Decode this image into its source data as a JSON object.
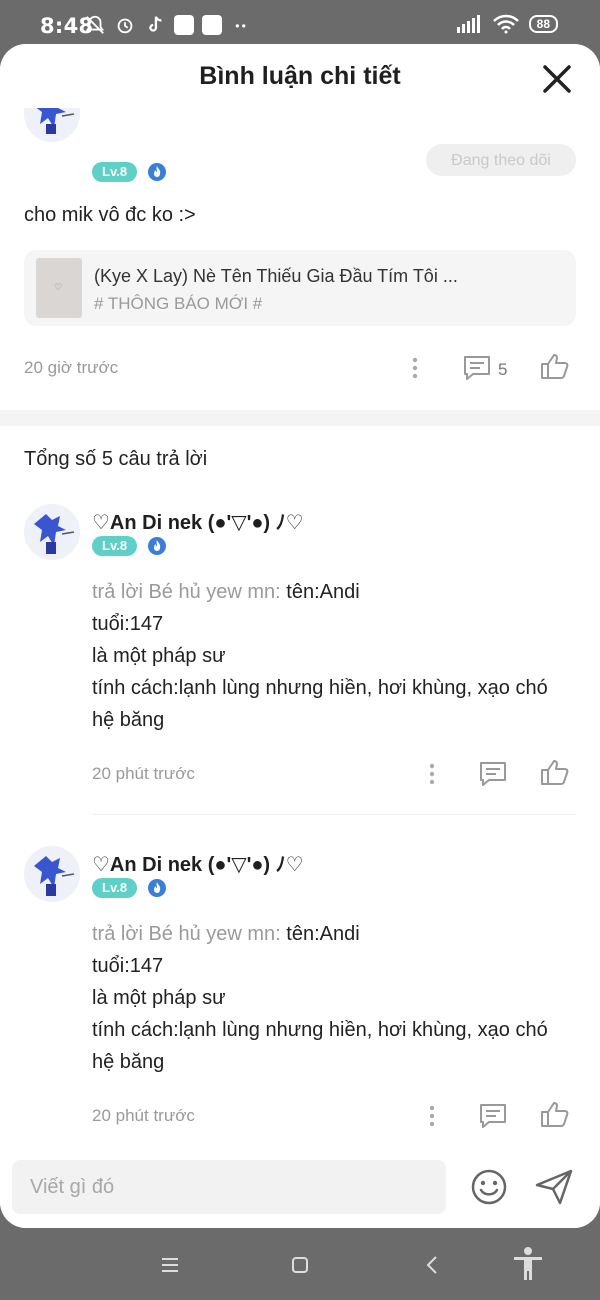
{
  "status_bar": {
    "time": "8:48",
    "battery": "88"
  },
  "header": {
    "title": "Bình luận chi tiết"
  },
  "top_comment": {
    "level": "Lv.8",
    "follow_label": "Đang theo dõi",
    "text": "cho mik vô đc ko :>",
    "story": {
      "thumb_glyph": "♡",
      "title": "(Kye X Lay) Nè Tên Thiếu Gia Đầu Tím Tôi ...",
      "tag": "# THÔNG BÁO MỚI #"
    },
    "time": "20 giờ trước",
    "reply_count": "5"
  },
  "total_replies": "Tổng số 5 câu trả lời",
  "replies": [
    {
      "name": "♡An Di nek (●'▽'●) ﾉ♡",
      "level": "Lv.8",
      "reply_prefix": "trả lời Bé hủ yew mn:",
      "line1": " tên:Andi",
      "line2": "tuổi:147",
      "line3": "là một pháp sư",
      "line4": "tính cách:lạnh lùng nhưng hiền, hơi khùng, xạo chó",
      "line5": "hệ băng",
      "time": "20 phút trước"
    },
    {
      "name": "♡An Di nek (●'▽'●) ﾉ♡",
      "level": "Lv.8",
      "reply_prefix": "trả lời Bé hủ yew mn:",
      "line1": " tên:Andi",
      "line2": "tuổi:147",
      "line3": "là một pháp sư",
      "line4": "tính cách:lạnh lùng nhưng hiền, hơi khùng, xạo chó",
      "line5": "hệ băng",
      "time": "20 phút trước"
    }
  ],
  "input": {
    "placeholder": "Viết gì đó"
  },
  "colors": {
    "level_badge": "#5fd0c7",
    "vip_icon": "#3a7fd5",
    "muted_text": "#9a9a9a"
  },
  "icons": {
    "close": "close-icon",
    "more": "more-vertical-icon",
    "comment": "comment-icon",
    "like": "thumbs-up-icon",
    "emoji": "smiley-icon",
    "send": "send-icon",
    "vip": "vip-flame-icon"
  }
}
